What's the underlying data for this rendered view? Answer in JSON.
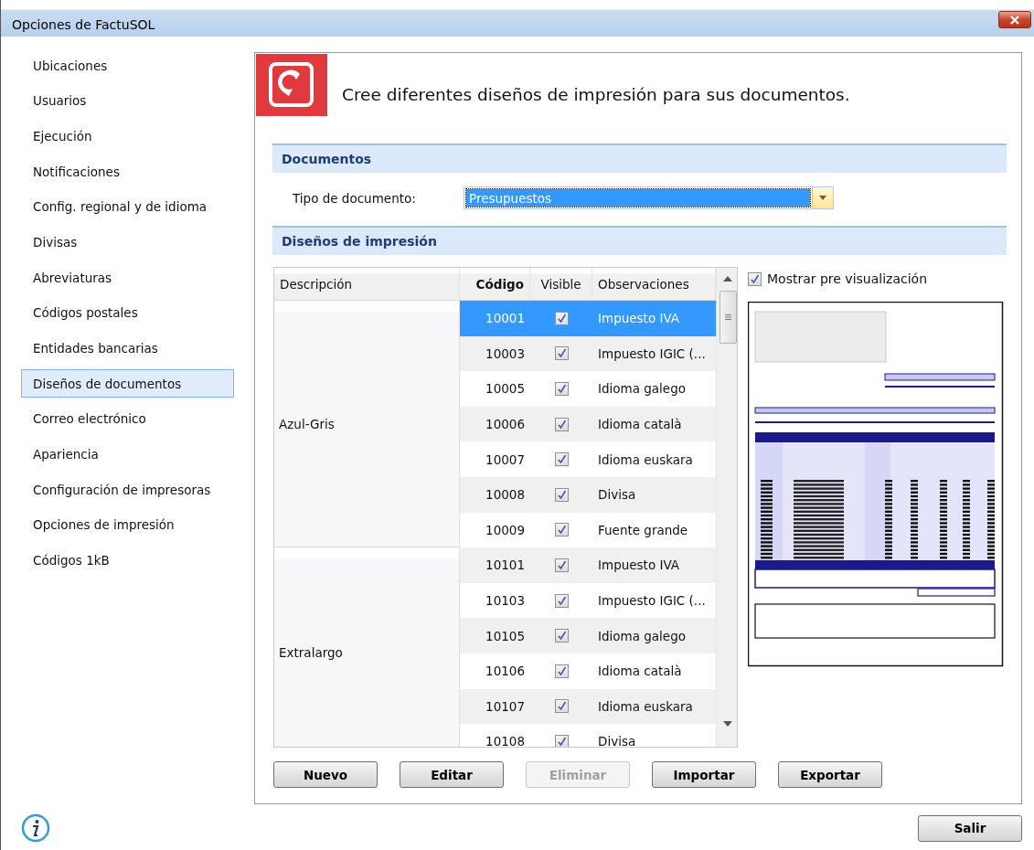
{
  "window": {
    "title": "Opciones de FactuSOL"
  },
  "sidebar": {
    "items": [
      {
        "label": "Ubicaciones",
        "selected": false
      },
      {
        "label": "Usuarios",
        "selected": false
      },
      {
        "label": "Ejecución",
        "selected": false
      },
      {
        "label": "Notificaciones",
        "selected": false
      },
      {
        "label": "Config. regional y de idioma",
        "selected": false
      },
      {
        "label": "Divisas",
        "selected": false
      },
      {
        "label": "Abreviaturas",
        "selected": false
      },
      {
        "label": "Códigos postales",
        "selected": false
      },
      {
        "label": "Entidades bancarias",
        "selected": false
      },
      {
        "label": "Diseños de documentos",
        "selected": true
      },
      {
        "label": "Correo electrónico",
        "selected": false
      },
      {
        "label": "Apariencia",
        "selected": false
      },
      {
        "label": "Configuración de impresoras",
        "selected": false
      },
      {
        "label": "Opciones de impresión",
        "selected": false
      },
      {
        "label": "Códigos 1kB",
        "selected": false
      }
    ]
  },
  "header": {
    "text": "Cree diferentes diseños de impresión para sus documentos."
  },
  "documents_section": {
    "title": "Documentos",
    "field_label": "Tipo de documento:",
    "value": "Presupuestos"
  },
  "designs_section": {
    "title": "Diseños de impresión",
    "columns": [
      "Descripción",
      "Código",
      "Visible",
      "Observaciones"
    ],
    "groups": [
      {
        "description": "Azul-Gris",
        "rows": [
          {
            "code": "10001",
            "visible": true,
            "observations": "Impuesto IVA",
            "selected": true
          },
          {
            "code": "10003",
            "visible": true,
            "observations": "Impuesto IGIC (...",
            "selected": false
          },
          {
            "code": "10005",
            "visible": true,
            "observations": "Idioma galego",
            "selected": false
          },
          {
            "code": "10006",
            "visible": true,
            "observations": "Idioma català",
            "selected": false
          },
          {
            "code": "10007",
            "visible": true,
            "observations": "Idioma euskara",
            "selected": false
          },
          {
            "code": "10008",
            "visible": true,
            "observations": "Divisa",
            "selected": false
          },
          {
            "code": "10009",
            "visible": true,
            "observations": "Fuente grande",
            "selected": false
          }
        ]
      },
      {
        "description": "Extralargo",
        "rows": [
          {
            "code": "10101",
            "visible": true,
            "observations": "Impuesto IVA",
            "selected": false
          },
          {
            "code": "10103",
            "visible": true,
            "observations": "Impuesto IGIC (...",
            "selected": false
          },
          {
            "code": "10105",
            "visible": true,
            "observations": "Idioma galego",
            "selected": false
          },
          {
            "code": "10106",
            "visible": true,
            "observations": "Idioma català",
            "selected": false
          },
          {
            "code": "10107",
            "visible": true,
            "observations": "Idioma euskara",
            "selected": false
          },
          {
            "code": "10108",
            "visible": true,
            "observations": "Divisa",
            "selected": false
          }
        ]
      }
    ]
  },
  "preview": {
    "label": "Mostrar pre visualización",
    "checked": true
  },
  "buttons": [
    {
      "label": "Nuevo",
      "disabled": false
    },
    {
      "label": "Editar",
      "disabled": false
    },
    {
      "label": "Eliminar",
      "disabled": true
    },
    {
      "label": "Importar",
      "disabled": false
    },
    {
      "label": "Exportar",
      "disabled": false
    }
  ],
  "footer_button": {
    "label": "Salir"
  }
}
